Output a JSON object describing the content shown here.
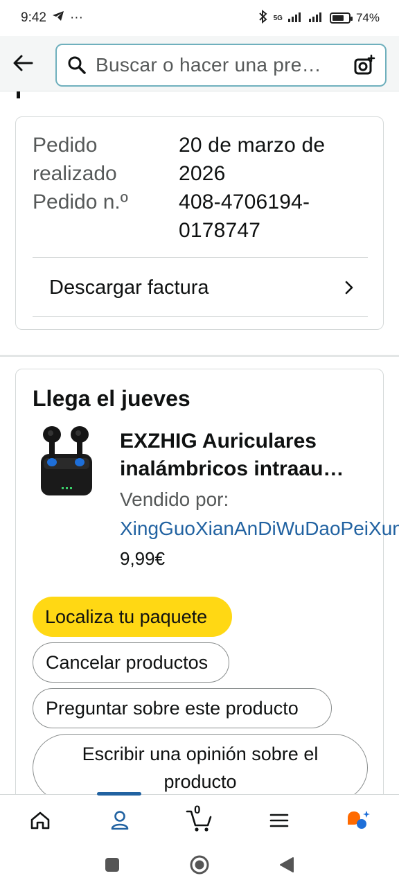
{
  "status_bar": {
    "time": "9:42",
    "more_indicator": "···",
    "network": "5G",
    "battery_percent": "74%",
    "battery_level": 0.74
  },
  "header": {
    "search_placeholder": "Buscar o hacer una pre…"
  },
  "order_info": {
    "placed_label": "Pedido realizado",
    "placed_value": "20 de marzo de 2026",
    "number_label": "Pedido n.º",
    "number_value": "408-4706194-0178747",
    "invoice_label": "Descargar factura"
  },
  "shipment": {
    "title": "Llega el jueves",
    "product_name": "EXZHIG Auriculares inalámbricos intraau…",
    "sold_by_label": "Vendido por:",
    "seller": "XingGuoXianAnDiWuDaoPeiXun",
    "price": "9,99€",
    "actions": {
      "track": "Localiza tu paquete",
      "cancel": "Cancelar productos",
      "ask": "Preguntar sobre este producto",
      "review": "Escribir una opinión sobre el producto"
    }
  },
  "bottom_nav": {
    "cart_count": "0",
    "icons": [
      "home-icon",
      "account-icon",
      "cart-icon",
      "menu-icon",
      "rufus-icon"
    ],
    "active": "account-icon",
    "accent_color": "#2162a1"
  },
  "colors": {
    "primary_button": "#ffd814",
    "link": "#2162a1",
    "secondary_text": "#565959"
  }
}
